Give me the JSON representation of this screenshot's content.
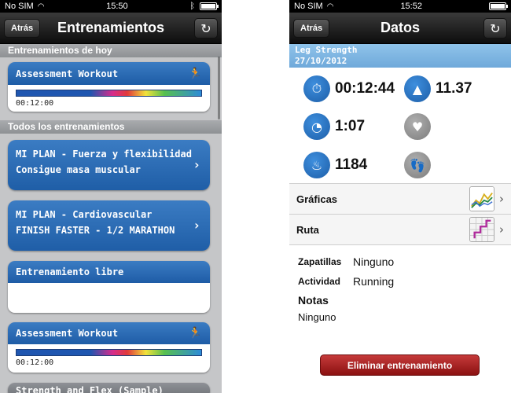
{
  "left": {
    "status": {
      "carrier": "No SIM",
      "time": "15:50"
    },
    "nav": {
      "back": "Atrás",
      "title": "Entrenamientos"
    },
    "sections": {
      "today": "Entrenamientos de hoy",
      "all": "Todos los entrenamientos"
    },
    "today_card": {
      "title": "Assessment Workout",
      "duration": "00:12:00"
    },
    "plan1": {
      "line1": "MI PLAN - Fuerza y flexibilidad",
      "line2": "Consigue masa muscular"
    },
    "plan2": {
      "line1": "MI PLAN - Cardiovascular",
      "line2": "FINISH FASTER - 1/2 MARATHON"
    },
    "free": {
      "title": "Entrenamiento libre"
    },
    "card2": {
      "title": "Assessment Workout",
      "duration": "00:12:00"
    },
    "partial": {
      "title": "Strength and Flex (Sample)"
    }
  },
  "right": {
    "status": {
      "carrier": "No SIM",
      "time": "15:52"
    },
    "nav": {
      "back": "Atrás",
      "title": "Datos"
    },
    "info": {
      "name": "Leg Strength",
      "date": "27/10/2012"
    },
    "metrics": {
      "time": "00:12:44",
      "distance": "11.37",
      "pace": "1:07",
      "calories": "1184"
    },
    "rows": {
      "graphs": "Gráficas",
      "route": "Ruta"
    },
    "details": {
      "shoes_label": "Zapatillas",
      "shoes_value": "Ninguno",
      "activity_label": "Actividad",
      "activity_value": "Running",
      "notes_label": "Notas",
      "notes_value": "Ninguno"
    },
    "delete": "Eliminar entrenamiento"
  }
}
